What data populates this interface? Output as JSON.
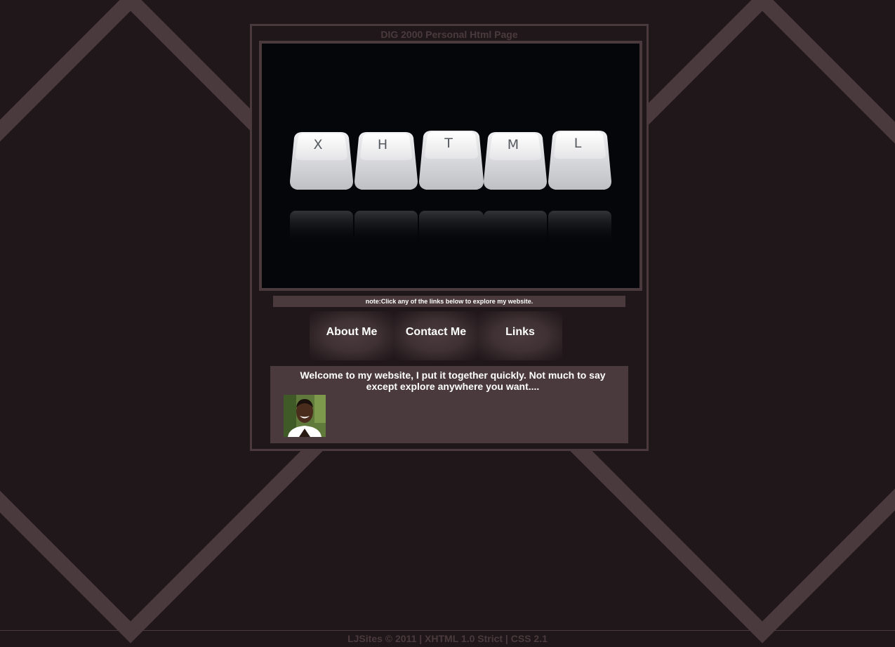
{
  "page": {
    "title": "DIG 2000 Personal Html Page"
  },
  "hero": {
    "keys": [
      "X",
      "H",
      "T",
      "M",
      "L"
    ]
  },
  "note": "note:Click any of the links below to explore my website.",
  "nav": {
    "items": [
      {
        "label": "About Me"
      },
      {
        "label": "Contact Me"
      },
      {
        "label": "Links"
      }
    ]
  },
  "welcome": {
    "text": "Welcome to my website, I put it together quickly. Not much to say except explore anywhere you want...."
  },
  "footer": "LJSites © 2011 | XHTML 1.0 Strict | CSS 2.1",
  "colors": {
    "background": "#20171a",
    "accent": "#4a3a3d",
    "text": "#ffffff"
  }
}
